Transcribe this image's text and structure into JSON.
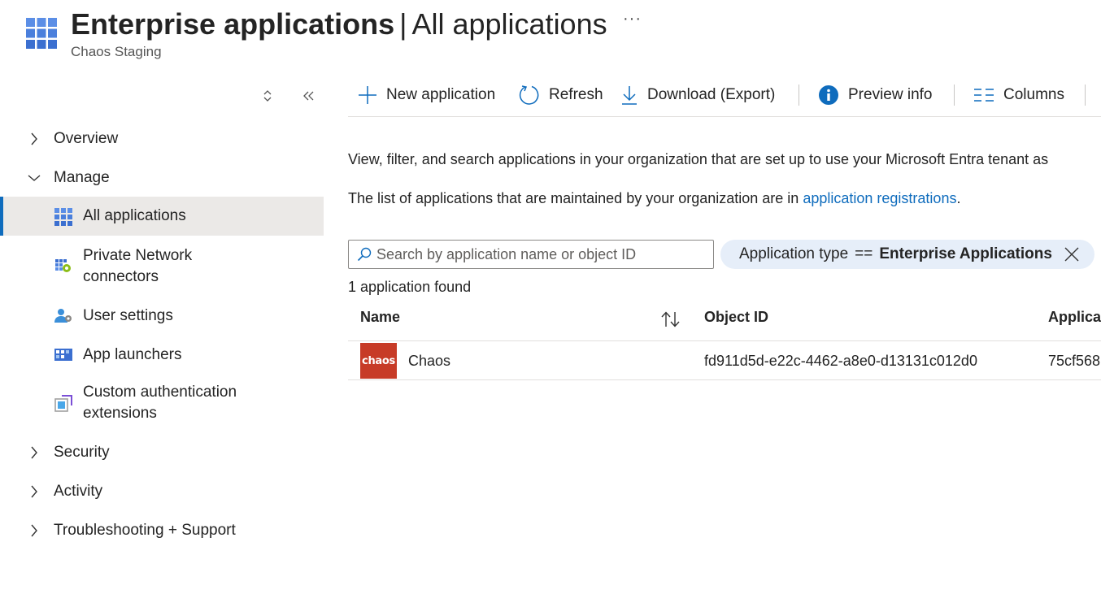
{
  "header": {
    "title": "Enterprise applications",
    "separator": "|",
    "subtitle": "All applications",
    "more": "···",
    "tenant": "Chaos Staging"
  },
  "sidebar": {
    "overview": "Overview",
    "manage": "Manage",
    "sub_items": [
      {
        "label": "All applications",
        "icon": "grid-icon",
        "active": true
      },
      {
        "label": "Private Network connectors",
        "icon": "network-connector-icon"
      },
      {
        "label": "User settings",
        "icon": "user-settings-icon"
      },
      {
        "label": "App launchers",
        "icon": "app-launcher-icon"
      },
      {
        "label": "Custom authentication extensions",
        "icon": "custom-extension-icon"
      }
    ],
    "security": "Security",
    "activity": "Activity",
    "troubleshooting": "Troubleshooting + Support"
  },
  "toolbar": {
    "new_application": "New application",
    "refresh": "Refresh",
    "download": "Download (Export)",
    "preview_info": "Preview info",
    "columns": "Columns"
  },
  "main": {
    "description_1": "View, filter, and search applications in your organization that are set up to use your Microsoft Entra tenant as",
    "description_2_prefix": "The list of applications that are maintained by your organization are in",
    "description_2_link": "application registrations",
    "description_2_suffix": ".",
    "search_placeholder": "Search by application name or object ID",
    "filter": {
      "key": "Application type",
      "operator": "==",
      "value": "Enterprise Applications"
    },
    "result_count": "1 application found"
  },
  "table": {
    "columns": [
      "Name",
      "Object ID",
      "Applica"
    ],
    "rows": [
      {
        "logo_text": "chaos",
        "name": "Chaos",
        "object_id": "fd911d5d-e22c-4462-a8e0-d13131c012d0",
        "app_id": "75cf568"
      }
    ]
  },
  "colors": {
    "accent": "#0f6cbd",
    "active_bg": "#ebe9e7",
    "filter_pill": "#e6eef9",
    "app_logo_bg": "#c73b27"
  }
}
